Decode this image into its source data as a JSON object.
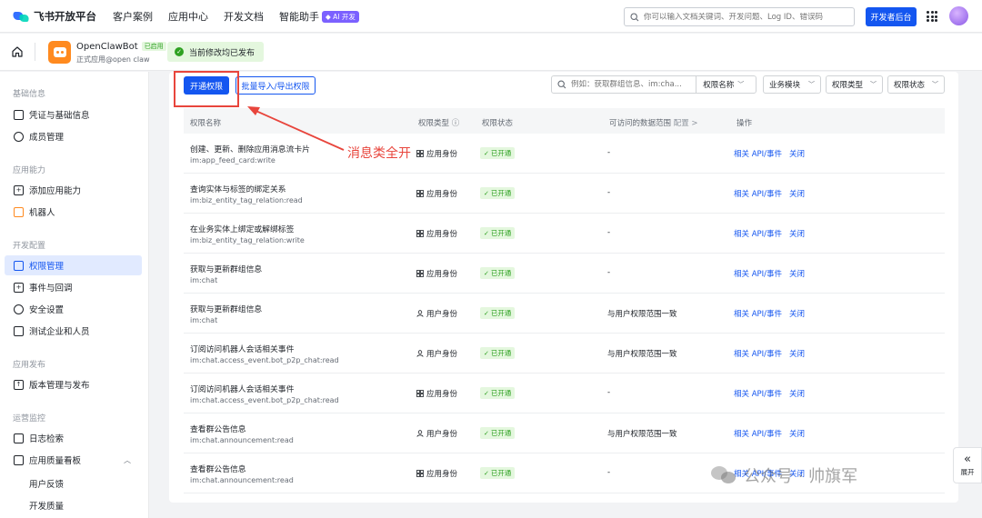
{
  "topbar": {
    "brand": "飞书开放平台",
    "nav": [
      "客户案例",
      "应用中心",
      "开发文档",
      "智能助手"
    ],
    "ai_badge": "◆ AI 开发",
    "search_placeholder": "你可以输入文档关键词、开发问题、Log ID、错误码",
    "dev_console": "开发者后台"
  },
  "appbar": {
    "app_name": "OpenClawBot",
    "app_tag": "已启用",
    "app_sub": "正式应用@open claw",
    "publish_status": "当前修改均已发布"
  },
  "sidebar": {
    "groups": [
      "基础信息",
      "应用能力",
      "开发配置",
      "应用发布",
      "运营监控"
    ],
    "items": {
      "credentials": "凭证与基础信息",
      "members": "成员管理",
      "add_capability": "添加应用能力",
      "robot": "机器人",
      "permissions": "权限管理",
      "events": "事件与回调",
      "security": "安全设置",
      "test_org": "测试企业和人员",
      "versions": "版本管理与发布",
      "logs": "日志检索",
      "quality": "应用质量看板",
      "feedback": "用户反馈",
      "dev_quality": "开发质量"
    }
  },
  "toolbar": {
    "enable_label": "开通权限",
    "import_label": "批量导入/导出权限",
    "search_placeholder": "例如：获取群组信息、im:cha...",
    "search_scope": "权限名称",
    "filters": [
      "业务模块",
      "权限类型",
      "权限状态"
    ]
  },
  "table": {
    "headers": {
      "name": "权限名称",
      "type": "权限类型",
      "status": "权限状态",
      "scope": "可访问的数据范围",
      "scope_link": "配置 >",
      "ops": "操作"
    },
    "rows": [
      {
        "name": "创建、更新、删除应用消息流卡片",
        "code": "im:app_feed_card:write",
        "type": "应用身份",
        "type_kind": "app",
        "status": "已开通",
        "scope": "-",
        "op1": "相关 API/事件",
        "op2": "关闭"
      },
      {
        "name": "查询实体与标签的绑定关系",
        "code": "im:biz_entity_tag_relation:read",
        "type": "应用身份",
        "type_kind": "app",
        "status": "已开通",
        "scope": "-",
        "op1": "相关 API/事件",
        "op2": "关闭"
      },
      {
        "name": "在业务实体上绑定或解绑标签",
        "code": "im:biz_entity_tag_relation:write",
        "type": "应用身份",
        "type_kind": "app",
        "status": "已开通",
        "scope": "-",
        "op1": "相关 API/事件",
        "op2": "关闭"
      },
      {
        "name": "获取与更新群组信息",
        "code": "im:chat",
        "type": "应用身份",
        "type_kind": "app",
        "status": "已开通",
        "scope": "-",
        "op1": "相关 API/事件",
        "op2": "关闭"
      },
      {
        "name": "获取与更新群组信息",
        "code": "im:chat",
        "type": "用户身份",
        "type_kind": "user",
        "status": "已开通",
        "scope": "与用户权限范围一致",
        "op1": "相关 API/事件",
        "op2": "关闭"
      },
      {
        "name": "订阅访问机器人会话相关事件",
        "code": "im:chat.access_event.bot_p2p_chat:read",
        "type": "用户身份",
        "type_kind": "user",
        "status": "已开通",
        "scope": "与用户权限范围一致",
        "op1": "相关 API/事件",
        "op2": "关闭"
      },
      {
        "name": "订阅访问机器人会话相关事件",
        "code": "im:chat.access_event.bot_p2p_chat:read",
        "type": "应用身份",
        "type_kind": "app",
        "status": "已开通",
        "scope": "-",
        "op1": "相关 API/事件",
        "op2": "关闭"
      },
      {
        "name": "查看群公告信息",
        "code": "im:chat.announcement:read",
        "type": "用户身份",
        "type_kind": "user",
        "status": "已开通",
        "scope": "与用户权限范围一致",
        "op1": "相关 API/事件",
        "op2": "关闭"
      },
      {
        "name": "查看群公告信息",
        "code": "im:chat.announcement:read",
        "type": "应用身份",
        "type_kind": "app",
        "status": "已开通",
        "scope": "-",
        "op1": "相关 API/事件",
        "op2": "关闭"
      }
    ]
  },
  "annotation": {
    "text": "消息类全开",
    "color": "#e8453c"
  },
  "expand_label": "展开",
  "watermark": "公众号 · 帅旗军",
  "colors": {
    "primary": "#1456f0",
    "success": "#2ea121",
    "success_bg": "#e4f7de",
    "accent": "#e8453c"
  }
}
